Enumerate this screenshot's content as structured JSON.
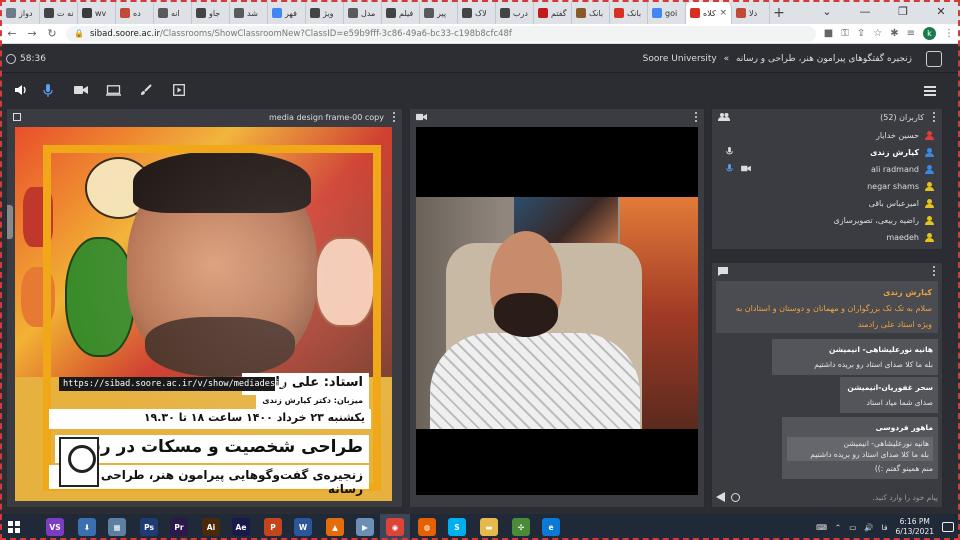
{
  "browser": {
    "tabs": [
      {
        "label": "دواز",
        "color": "#6d7b8a"
      },
      {
        "label": "نه ت",
        "color": "#444"
      },
      {
        "label": "wv",
        "color": "#3b3b3b"
      },
      {
        "label": "ده",
        "color": "#c14a3a"
      },
      {
        "label": "انه",
        "color": "#5a5a5a"
      },
      {
        "label": "جاو",
        "color": "#444"
      },
      {
        "label": "شد",
        "color": "#5a5a5a"
      },
      {
        "label": "فهر",
        "color": "#4285f4"
      },
      {
        "label": "ویژ",
        "color": "#444"
      },
      {
        "label": "مدل",
        "color": "#5a5a5a"
      },
      {
        "label": "فیلم",
        "color": "#444"
      },
      {
        "label": "پیر",
        "color": "#5a5a5a"
      },
      {
        "label": "لاک",
        "color": "#444"
      },
      {
        "label": "درب",
        "color": "#444"
      },
      {
        "label": "گفتم",
        "color": "#c21b1b"
      },
      {
        "label": "بانک",
        "color": "#8b5a2b"
      },
      {
        "label": "بانک",
        "color": "#d93025"
      },
      {
        "label": "goi",
        "color": "#4285f4"
      },
      {
        "label": "کلاه",
        "color": "#d93025"
      },
      {
        "label": "دلا",
        "color": "#c14a3a"
      }
    ],
    "active_tab_label": "کلاه",
    "new_tab": "+",
    "url_host": "sibad.soore.ac.ir",
    "url_path": "/Classrooms/ShowClassroomNew?ClassID=e59b9fff-3c86-49a6-bc33-c198b8cfc48f",
    "profile_letter": "k",
    "window_controls": [
      "⌄",
      "—",
      "❐",
      "✕"
    ]
  },
  "app": {
    "timer": "58:36",
    "breadcrumb_root": "Soore University",
    "breadcrumb_sep": "»",
    "breadcrumb_current": "زنجیره گفتگوهای پیرامون هنر، طراحی و رسانه"
  },
  "presentation": {
    "title": "media design frame-00 copy",
    "slide": {
      "url": "https://sibad.soore.ac.ir/v/show/mediadesign",
      "teacher": "استاد: علی رادمند",
      "host": "میزبان: دکتر کیارش زندی",
      "date": "یکشنبه ۲۳ خرداد ۱۴۰۰ ساعت ۱۸ تا ۱۹.۳۰",
      "talk_title": "طراحی شخصیت و مسکات در رسانه",
      "series": "زنجیره‌ی گفت‌وگوهایی پیرامون هنر، طراحی و رسانه"
    }
  },
  "users": {
    "title": "کاربران (52)",
    "list": [
      {
        "name": "حسین خدایار",
        "bold": false,
        "color": "#e03c3c",
        "mic": false,
        "cam": false
      },
      {
        "name": "کیارش زندی",
        "bold": true,
        "color": "#3a88e0",
        "mic": true,
        "cam": false
      },
      {
        "name": "ali radmand",
        "bold": false,
        "color": "#3a88e0",
        "mic": true,
        "cam": true
      },
      {
        "name": "negar shams",
        "bold": false,
        "color": "#e8c21c",
        "mic": false,
        "cam": false
      },
      {
        "name": "امیرعباس باقی",
        "bold": false,
        "color": "#e8c21c",
        "mic": false,
        "cam": false
      },
      {
        "name": "راضیه ربیعی، تصویرسازی",
        "bold": false,
        "color": "#e8c21c",
        "mic": false,
        "cam": false
      },
      {
        "name": "maedeh",
        "bold": false,
        "color": "#e8c21c",
        "mic": false,
        "cam": false
      }
    ]
  },
  "chat": {
    "self_name": "کیارش زندی",
    "self_text": "سلام به تک تک بزرگواران و مهمانان و دوستان و استادان به ویژه استاد علی رادمند",
    "messages": [
      {
        "name": "هانیه نورعلیشاهی- انیمیشن",
        "text": "بله ما کلا صدای استاد رو بریده داشتیم"
      },
      {
        "name": "سحر غفوریان-انیمیشن",
        "text": "صدای شما میاد استاد"
      },
      {
        "name": "ماهور فردوسی",
        "quote_name": "هانیه نورعلیشاهی- انیمیشن",
        "quote_text": "بله ما کلا صدای استاد رو بریده داشتیم",
        "text": "منم همینو گفتم :))"
      }
    ],
    "input_placeholder": "پیام خود را وارد کنید."
  },
  "taskbar": {
    "apps": [
      {
        "label": "VS",
        "color": "#7b3ec2"
      },
      {
        "label": "⬇",
        "color": "#3a6fb0"
      },
      {
        "label": "▦",
        "color": "#5d7fa0"
      },
      {
        "label": "Ps",
        "color": "#1e3c73"
      },
      {
        "label": "Pr",
        "color": "#2a1a4a"
      },
      {
        "label": "Ai",
        "color": "#4a2a0a"
      },
      {
        "label": "Ae",
        "color": "#1a1a4a"
      },
      {
        "label": "P",
        "color": "#c4451c"
      },
      {
        "label": "W",
        "color": "#2b579a"
      },
      {
        "label": "▲",
        "color": "#e46c0a"
      },
      {
        "label": "▶",
        "color": "#6b8fb5"
      },
      {
        "label": "◉",
        "color": "#db4437"
      },
      {
        "label": "◍",
        "color": "#e66000"
      },
      {
        "label": "S",
        "color": "#00aff0"
      },
      {
        "label": "▬",
        "color": "#e7b84a"
      },
      {
        "label": "✣",
        "color": "#4a8b3a"
      },
      {
        "label": "e",
        "color": "#0c7ad5"
      }
    ],
    "lang": "فا",
    "time": "6:16 PM",
    "date": "6/13/2021"
  }
}
